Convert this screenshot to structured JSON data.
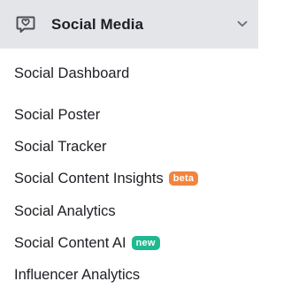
{
  "section": {
    "title": "Social Media",
    "icon": "chat-bubble-icon",
    "toggle_icon": "chevron-down-icon",
    "header_bg": "#e4e5e8"
  },
  "menu": {
    "items": [
      {
        "label": "Social Dashboard",
        "badge": ""
      },
      {
        "label": "Social Poster",
        "badge": ""
      },
      {
        "label": "Social Tracker",
        "badge": ""
      },
      {
        "label": "Social Content Insights",
        "badge": "beta",
        "badge_color": "#f2843d"
      },
      {
        "label": "Social Analytics",
        "badge": ""
      },
      {
        "label": "Social Content AI",
        "badge": "new",
        "badge_color": "#1fb98f"
      },
      {
        "label": "Influencer Analytics",
        "badge": ""
      }
    ]
  }
}
